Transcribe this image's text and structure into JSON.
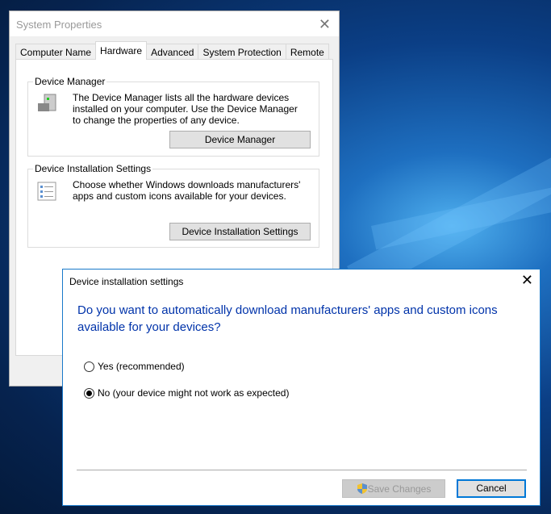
{
  "system_properties": {
    "title": "System Properties",
    "tabs": [
      {
        "label": "Computer Name"
      },
      {
        "label": "Hardware",
        "active": true
      },
      {
        "label": "Advanced"
      },
      {
        "label": "System Protection"
      },
      {
        "label": "Remote"
      }
    ],
    "device_manager": {
      "label": "Device Manager",
      "description": "The Device Manager lists all the hardware devices installed on your computer. Use the Device Manager to change the properties of any device.",
      "button": "Device Manager"
    },
    "device_installation": {
      "label": "Device Installation Settings",
      "description": "Choose whether Windows downloads manufacturers' apps and custom icons available for your devices.",
      "button": "Device Installation Settings"
    }
  },
  "dialog": {
    "title": "Device installation settings",
    "question": "Do you want to automatically download manufacturers' apps and custom icons available for your devices?",
    "options": [
      {
        "label": "Yes (recommended)",
        "selected": false
      },
      {
        "label": "No (your device might not work as expected)",
        "selected": true
      }
    ],
    "save_button": "Save Changes",
    "cancel_button": "Cancel",
    "accent": "#1979ca"
  }
}
